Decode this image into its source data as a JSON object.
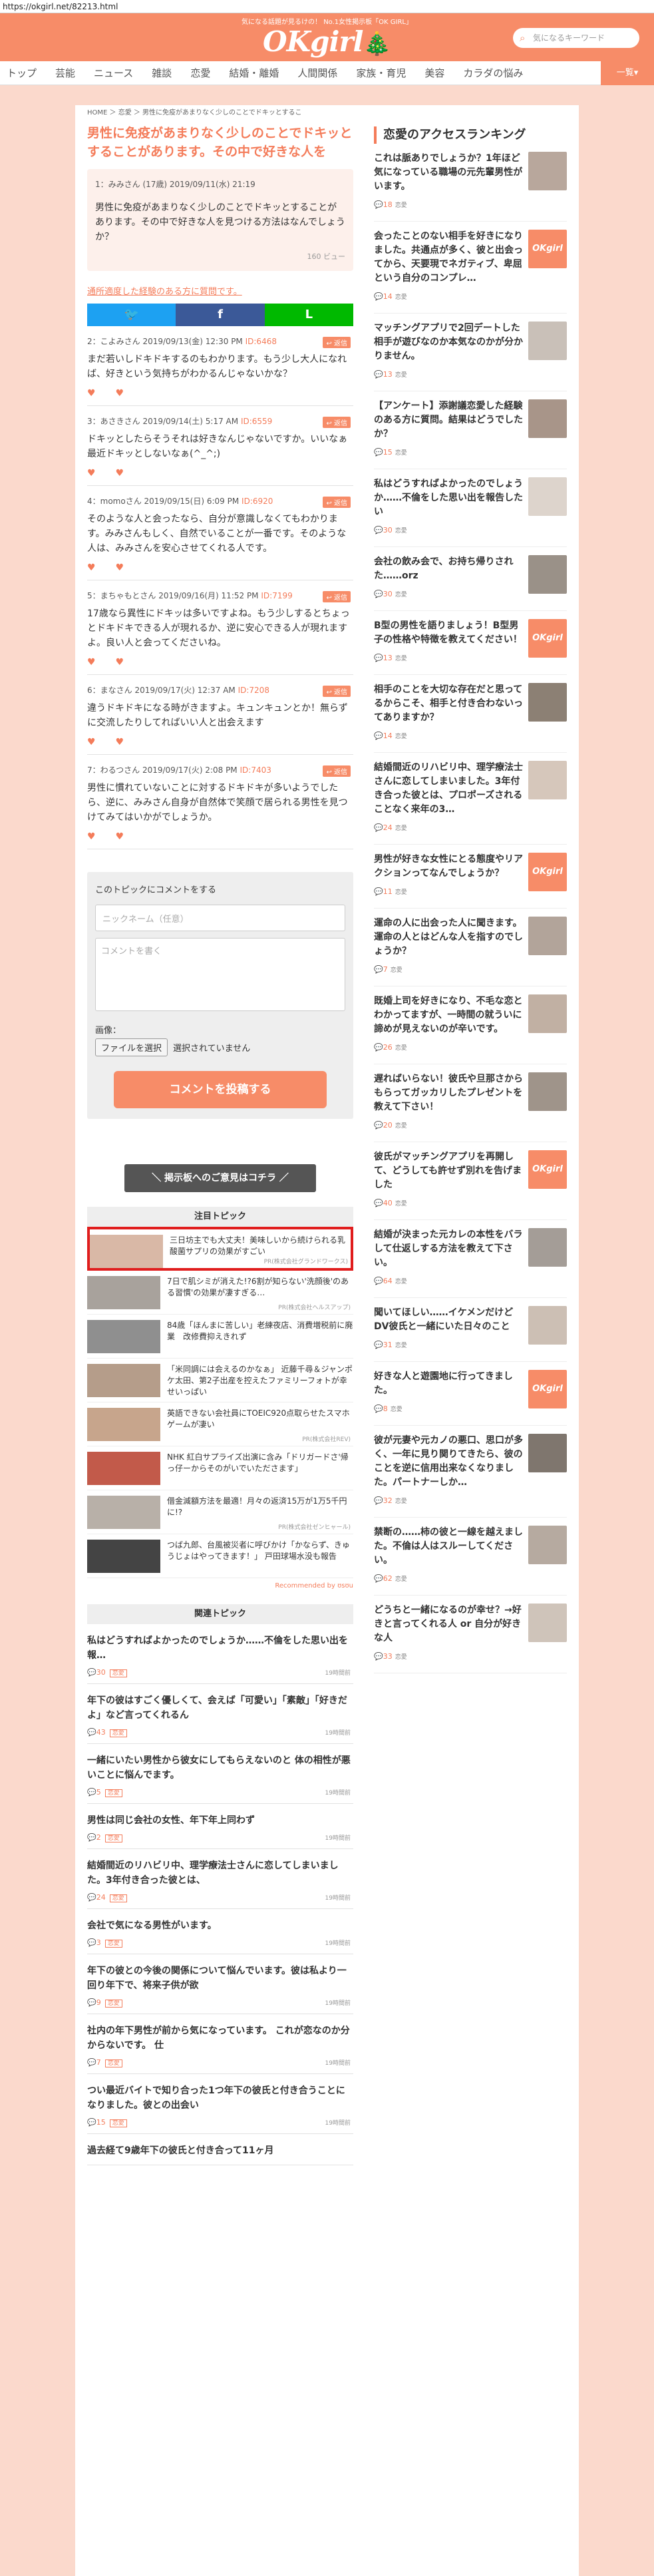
{
  "url": "https://okgirl.net/82213.html",
  "header": {
    "tagline": "気になる話題が見るけの！ No.1女性掲示板「OK GIRL」",
    "logo": "OKgirl",
    "tree_icon": "tree-icon",
    "search_placeholder": "気になるキーワード"
  },
  "nav": {
    "items": [
      "トップ",
      "芸能",
      "ニュース",
      "雑談",
      "恋愛",
      "結婚・離婚",
      "人間関係",
      "家族・育児",
      "美容",
      "カラダの悩み"
    ],
    "more": "一覧▾"
  },
  "breadcrumb": "HOME ＞ 恋愛 ＞ 男性に免疫があまりなく少しのことでドキッとするこ",
  "topic": {
    "title": "男性に免疫があまりなく少しのことでドキッとすることがあります。その中で好きな人を",
    "first": {
      "meta": "1：みみさん (17歳) 2019/09/11(水) 21:19",
      "body": "男性に免疫があまりなく少しのことでドキッとすることがあります。その中で好きな人を見つける方法はなんでしょうか？",
      "views": "160 ビュー"
    },
    "edit_link": "通所適度した経験のある方に質問です。"
  },
  "share": {
    "twitter": "🐦",
    "facebook": "f",
    "line": "L"
  },
  "comments": [
    {
      "meta": "2：こよみさん 2019/09/13(金) 12:30 PM",
      "id": "ID:6468",
      "body": "まだ若いしドキドキするのもわかります。もう少し大人になれば、好きという気持ちがわかるんじゃないかな？"
    },
    {
      "meta": "3：あさきさん 2019/09/14(土) 5:17 AM",
      "id": "ID:6559",
      "body": "ドキッとしたらそうそれは好きなんじゃないですか。いいなぁ最近ドキッとしないなぁ(^_^;)"
    },
    {
      "meta": "4：momoさん 2019/09/15(日) 6:09 PM",
      "id": "ID:6920",
      "body": "そのような人と会ったなら、自分が意識しなくてもわかります。みみさんもしく、自然でいることが一番です。そのような人は、みみさんを安心させてくれる人です。"
    },
    {
      "meta": "5：まちゃもとさん 2019/09/16(月) 11:52 PM",
      "id": "ID:7199",
      "body": "17歳なら異性にドキッは多いですよね。もう少しするとちょっとドキドキできる人が現れるか、逆に安心できる人が現れますよ。良い人と会ってくださいね。"
    },
    {
      "meta": "6：まなさん 2019/09/17(火) 12:37 AM",
      "id": "ID:7208",
      "body": "違うドキドキになる時がきますよ。キュンキュンとか！無らずに交流したりしてればいい人と出会えます"
    },
    {
      "meta": "7：わるつさん 2019/09/17(火) 2:08 PM",
      "id": "ID:7403",
      "body": "男性に慣れていないことに対するドキドキが多いようでしたら、逆に、みみさん自身が自然体で笑顔で居られる男性を見つけてみてはいかがでしょうか。"
    }
  ],
  "reply_label": "↩ 返信",
  "form": {
    "label": "このトピックにコメントをする",
    "name_placeholder": "ニックネーム（任意）",
    "comment_placeholder": "コメントを書く",
    "image_label": "画像：",
    "file_button": "ファイルを選択",
    "file_status": "選択されていません",
    "submit": "コメントを投稿する"
  },
  "opinion_button": "＼ 掲示板へのご意見はコチラ ／",
  "featured": {
    "heading": "注目トピック",
    "ads": [
      {
        "text": "三日坊主でも大丈夫！美味しいから続けられる乳酸菌サプリの効果がすごい",
        "pr": "PR(株式会社グランドワークス)"
      },
      {
        "text": "7日で肌シミが消えた!?6割が知らない'洗顔後'のある習慣'の効果が凄すぎる…",
        "pr": "PR(株式会社ヘルスアップ)"
      },
      {
        "text": "84歳「ほんまに苦しい」老練夜店、消費増税前に廃業　改修費抑えきれず",
        "pr": ""
      },
      {
        "text": "「米同調には会えるのかなぁ」 近藤千尋＆ジャンポケ太田、第2子出産を控えたファミリーフォトが幸せいっぱい",
        "pr": ""
      },
      {
        "text": "英語できない会社員にTOEIC920点取らせたスマホゲームが凄い",
        "pr": "PR(株式会社REV)"
      },
      {
        "text": "NHK 紅白サプライズ出演に含み「ドリガードさ'帰っ仔ーからそのがいでいたださます」",
        "pr": ""
      },
      {
        "text": "借金減額方法を最適！月々の返済15万が1万5千円に!?",
        "pr": "PR(株式会社ゼンヒャール)"
      },
      {
        "text": "つば九郎、台風被災者に呼びかけ「かならず、きゅうじょはやってきます！」 戸田球場水没も報告",
        "pr": ""
      }
    ],
    "recommended_by": "Recommended by ʊsʊu"
  },
  "related": {
    "heading": "関連トピック",
    "items": [
      {
        "title": "私はどうすればよかったのでしょうか……不倫をした思い出を報…",
        "count": "30",
        "date": "19時間前"
      },
      {
        "title": "年下の彼はすごく優しくて、会えば「可愛い」「素敵」「好きだよ」など言ってくれるん",
        "count": "43",
        "date": "19時間前"
      },
      {
        "title": "一緒にいたい男性から彼女にしてもらえないのと 体の相性が悪いことに悩んでます。",
        "count": "5",
        "date": "19時間前"
      },
      {
        "title": "男性は同じ会社の女性、年下年上同わず",
        "count": "2",
        "date": "19時間前"
      },
      {
        "title": "結婚間近のリハビリ中、理学療法士さんに恋してしまいました。3年付き合った彼とは、",
        "count": "24",
        "date": "19時間前"
      },
      {
        "title": "会社で気になる男性がいます。",
        "count": "3",
        "date": "19時間前"
      },
      {
        "title": "年下の彼との今後の関係について悩んでいます。彼は私より一回り年下で、将来子供が欲",
        "count": "9",
        "date": "19時間前"
      },
      {
        "title": "社内の年下男性が前から気になっています。 これが恋なのか分からないです。 仕",
        "count": "7",
        "date": "19時間前"
      },
      {
        "title": "つい最近バイトで知り合った1つ年下の彼氏と付き合うことになりました。彼との出会い",
        "count": "15",
        "date": "19時間前"
      },
      {
        "title": "過去経て9歳年下の彼氏と付き合って11ヶ月",
        "count": "",
        "date": ""
      }
    ]
  },
  "ranking": {
    "heading": "恋愛のアクセスランキング",
    "items": [
      {
        "title": "これは脈ありでしょうか？1年ほど気になっている職場の元先輩男性がいます。",
        "count": "18"
      },
      {
        "title": "会ったことのない相手を好きになりました。共通点が多く、彼と出会ってから、天要現でネガティブ、卑屈という自分のコンプレ…",
        "count": "14"
      },
      {
        "title": "マッチングアプリで2回デートした相手が遊びなのか本気なのかが分かりません。",
        "count": "13"
      },
      {
        "title": "【アンケート】添謝議恋愛した経験のある方に質問。結果はどうでしたか？",
        "count": "15"
      },
      {
        "title": "私はどうすればよかったのでしょうか……不倫をした思い出を報告したい",
        "count": "30"
      },
      {
        "title": "会社の飲み会で、お持ち帰りされた……orz",
        "count": "30"
      },
      {
        "title": "B型の男性を語りましょう！B型男子の性格や特徴を教えてください！",
        "count": "13"
      },
      {
        "title": "相手のことを大切な存在だと思ってるからこそ、相手と付き合わないってありますか？",
        "count": "14"
      },
      {
        "title": "結婚間近のリハビリ中、理学療法士さんに恋してしまいました。3年付き合った彼とは、プロポーズされることなく来年の3…",
        "count": "24"
      },
      {
        "title": "男性が好きな女性にとる態度やリアクションってなんでしょうか？",
        "count": "11"
      },
      {
        "title": "運命の人に出会った人に聞きます。運命の人とはどんな人を指すのでしょうか？",
        "count": "7"
      },
      {
        "title": "既婚上司を好きになり、不毛な恋とわかってますが、一時間の就ういに諦めが見えないのが辛いです。",
        "count": "26"
      },
      {
        "title": "遅ればいらない！彼氏や旦那さからもらってガッカリしたプレゼントを教えて下さい！",
        "count": "20"
      },
      {
        "title": "彼氏がマッチングアプリを再開して、どうしても許せず別れを告げました",
        "count": "40"
      },
      {
        "title": "結婚が決まった元カレの本性をバラして仕返しする方法を教えて下さい。",
        "count": "64"
      },
      {
        "title": "聞いてほしい……イケメンだけどDV彼氏と一緒にいた日々のこと",
        "count": "31"
      },
      {
        "title": "好きな人と遊園地に行ってきました。",
        "count": "8"
      },
      {
        "title": "彼が元妻や元カノの悪口、思口が多く、一年に見り関りてきたら、彼のことを逆に信用出来なくなりました。パートナーしか…",
        "count": "32"
      },
      {
        "title": "禁断の……柿の彼と一線を越えました。不倫は人はスルーしてください。",
        "count": "62"
      },
      {
        "title": "どうちと一緒になるのが幸せ？→好きと言ってくれる人 or 自分が好きな人",
        "count": "33"
      }
    ],
    "tag": "恋愛"
  }
}
